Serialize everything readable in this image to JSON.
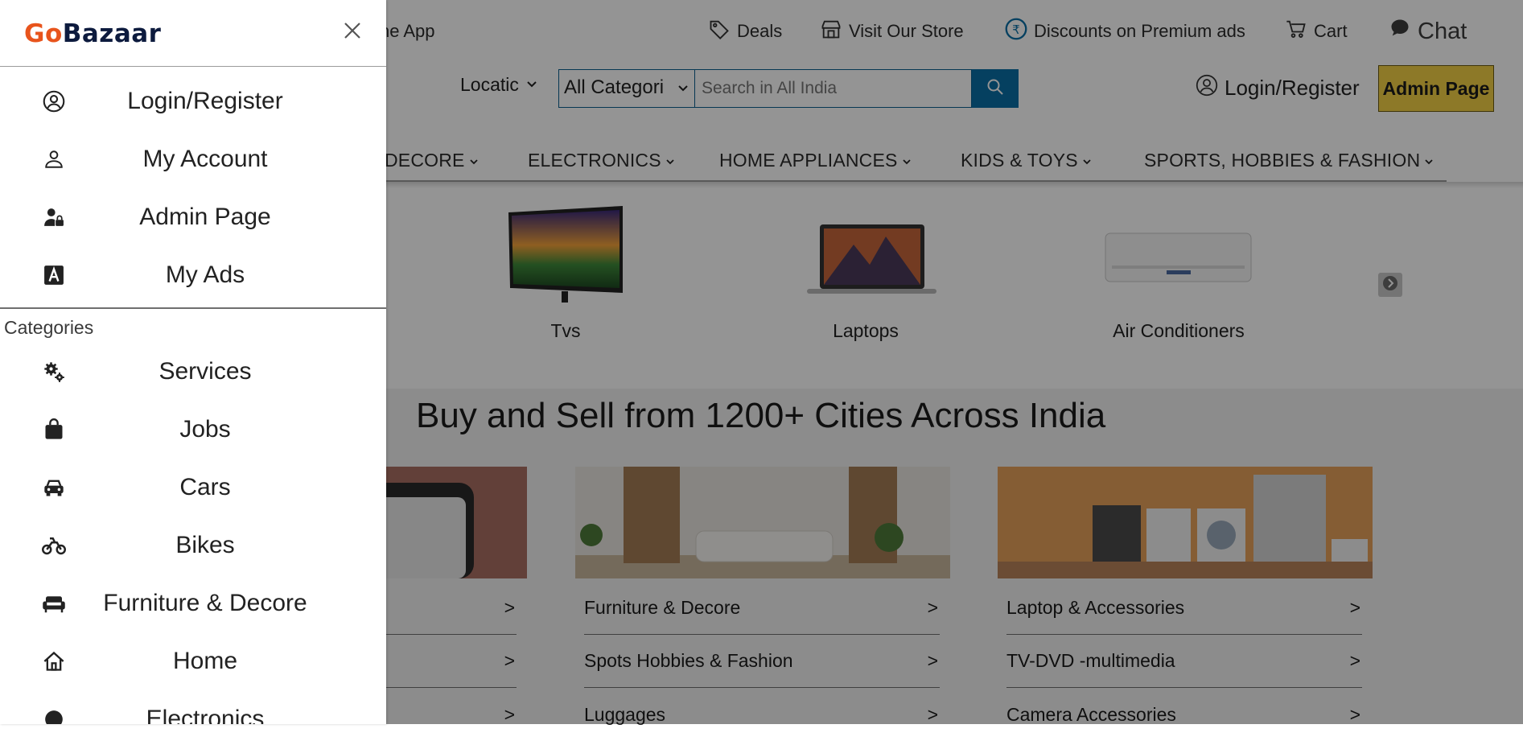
{
  "topbar": {
    "app_label": "he App",
    "deals": "Deals",
    "visit_store": "Visit Our Store",
    "discounts": "Discounts on Premium ads",
    "cart": "Cart",
    "chat": "Chat"
  },
  "search": {
    "location": "Locatic",
    "category": "All Categori",
    "placeholder": "Search in All India",
    "login": "Login/Register",
    "admin": "Admin Page"
  },
  "nav": {
    "items": [
      "DECORE",
      "ELECTRONICS",
      "HOME APPLIANCES",
      "KIDS & TOYS",
      "SPORTS, HOBBIES & FASHION"
    ]
  },
  "tiles": [
    "Tvs",
    "Laptops",
    "Air Conditioners"
  ],
  "hero": {
    "title": "Buy and Sell from 1200+ Cities Across India"
  },
  "cards": {
    "col1": [
      ">",
      ">",
      ">"
    ],
    "col2": [
      "Furniture & Decore",
      "Spots Hobbies & Fashion",
      "Luggages"
    ],
    "col3": [
      "Laptop & Accessories",
      "TV-DVD -multimedia",
      "Camera Accessories"
    ],
    "arrow": ">"
  },
  "drawer": {
    "logo_go": "Go",
    "logo_bazaar": "Bazaar",
    "account_items": [
      "Login/Register",
      "My Account",
      "Admin Page",
      "My Ads"
    ],
    "categories_heading": "Categories",
    "category_items": [
      "Services",
      "Jobs",
      "Cars",
      "Bikes",
      "Furniture & Decore",
      "Home",
      "Electronics"
    ]
  },
  "colors": {
    "brand_orange": "#e8541c",
    "brand_navy": "#0d1b3e",
    "search_blue": "#0a6fa6",
    "admin_yellow": "#f3d046"
  }
}
